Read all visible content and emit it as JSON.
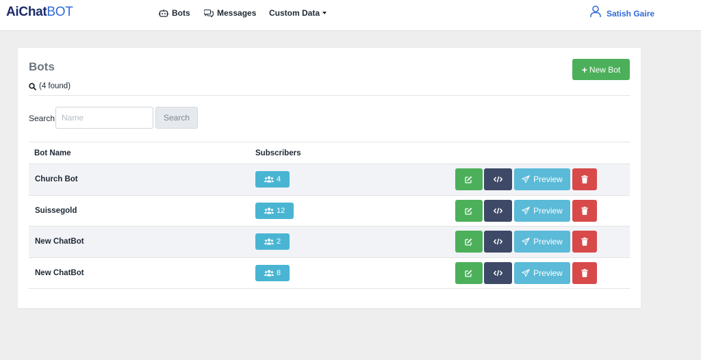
{
  "brand": {
    "part1": "AiChat",
    "part2": "BOT"
  },
  "nav": {
    "bots": "Bots",
    "messages": "Messages",
    "custom_data": "Custom Data"
  },
  "user": {
    "name": "Satish Gaire"
  },
  "card": {
    "title": "Bots",
    "found": "(4 found)",
    "new_bot_label": "New Bot",
    "new_bot_plus": "+"
  },
  "search": {
    "label": "Search",
    "placeholder": "Name",
    "button_label": "Search"
  },
  "table": {
    "headers": [
      "Bot Name",
      "Subscribers"
    ],
    "preview_label": "Preview",
    "rows": [
      {
        "name": "Church Bot",
        "subscribers": "4"
      },
      {
        "name": "Suissegold",
        "subscribers": "12"
      },
      {
        "name": "New ChatBot",
        "subscribers": "2"
      },
      {
        "name": "New ChatBot",
        "subscribers": "8"
      }
    ]
  },
  "colors": {
    "primary": "#2f6ad8",
    "success": "#4cb05a",
    "info": "#5bbad7",
    "dark": "#3d4966",
    "danger": "#d84a4a"
  }
}
